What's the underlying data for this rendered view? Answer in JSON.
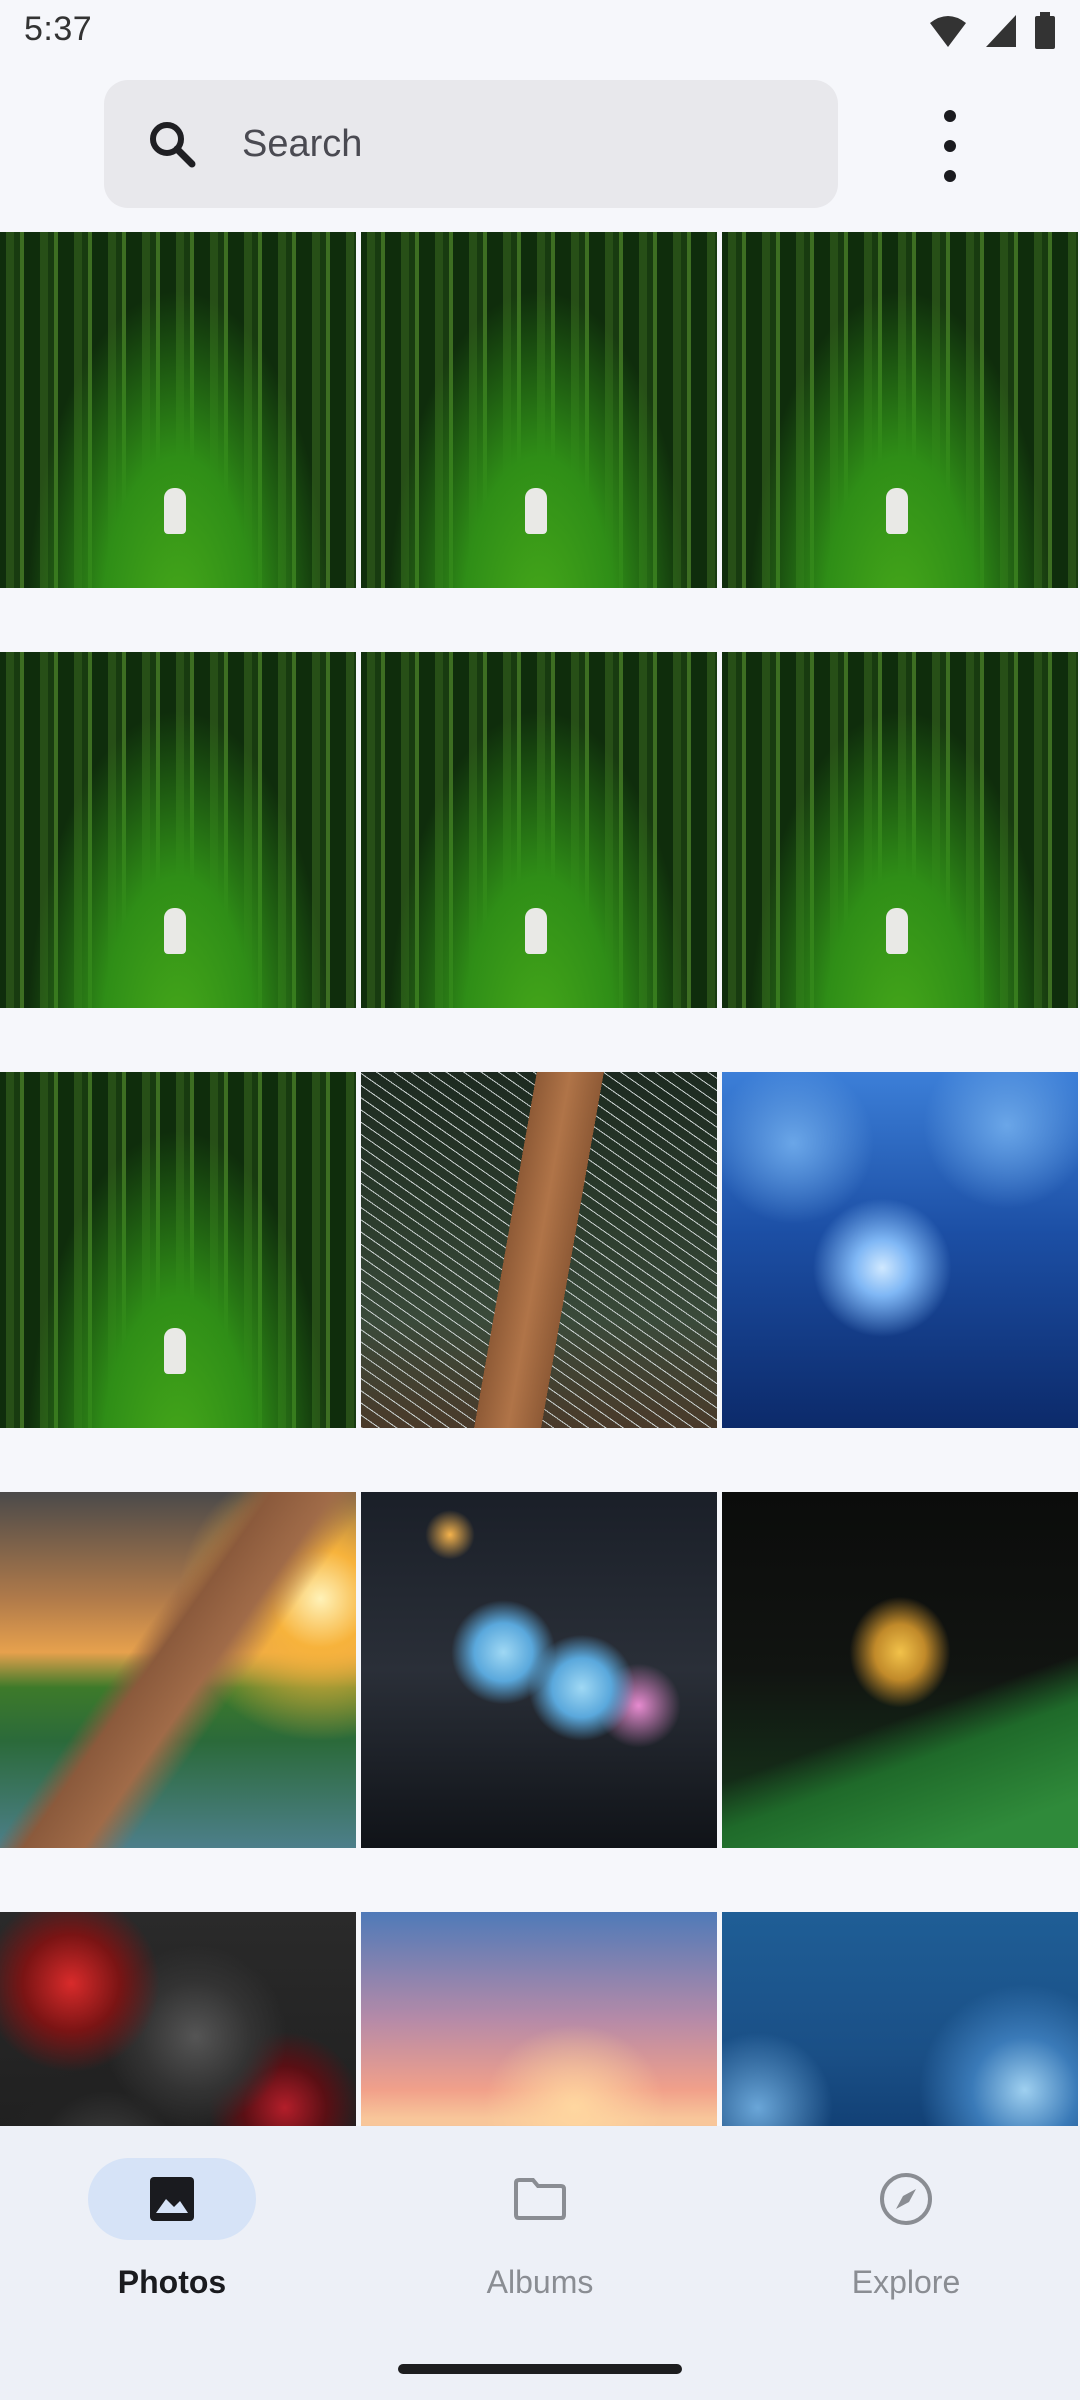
{
  "status_bar": {
    "time": "5:37",
    "icons": [
      "wifi-icon",
      "signal-icon",
      "battery-icon"
    ]
  },
  "search": {
    "placeholder": "Search",
    "icon": "search-icon"
  },
  "toolbar": {
    "more_icon": "more-vert-icon"
  },
  "grid": {
    "rows": [
      [
        "forest",
        "forest",
        "forest"
      ],
      [
        "forest",
        "forest",
        "forest"
      ],
      [
        "forest",
        "hanging-bridge",
        "water-fountain"
      ],
      [
        "sunset-dock",
        "blue-flowers",
        "golden-ganesha"
      ],
      [
        "red-stones",
        "mountain-sunset",
        "ocean-wave"
      ]
    ]
  },
  "bottom_nav": {
    "items": [
      {
        "label": "Photos",
        "icon": "photo-icon",
        "active": true
      },
      {
        "label": "Albums",
        "icon": "folder-icon",
        "active": false
      },
      {
        "label": "Explore",
        "icon": "compass-icon",
        "active": false
      }
    ]
  },
  "colors": {
    "background": "#f6f7fb",
    "search_bg": "#e8e8ec",
    "nav_bg": "#edf0f7",
    "active_pill": "#d6e3f7",
    "active_text": "#1a1b1f",
    "inactive_text": "#8a8d93"
  }
}
